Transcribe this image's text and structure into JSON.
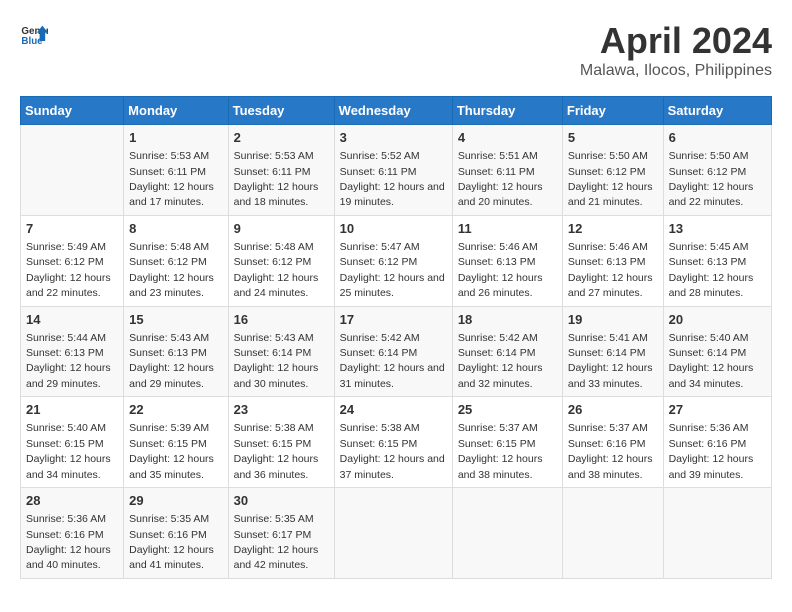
{
  "header": {
    "logo_line1": "General",
    "logo_line2": "Blue",
    "month": "April 2024",
    "location": "Malawa, Ilocos, Philippines"
  },
  "weekdays": [
    "Sunday",
    "Monday",
    "Tuesday",
    "Wednesday",
    "Thursday",
    "Friday",
    "Saturday"
  ],
  "weeks": [
    [
      {
        "day": "",
        "sunrise": "",
        "sunset": "",
        "daylight": ""
      },
      {
        "day": "1",
        "sunrise": "5:53 AM",
        "sunset": "6:11 PM",
        "daylight": "12 hours and 17 minutes."
      },
      {
        "day": "2",
        "sunrise": "5:53 AM",
        "sunset": "6:11 PM",
        "daylight": "12 hours and 18 minutes."
      },
      {
        "day": "3",
        "sunrise": "5:52 AM",
        "sunset": "6:11 PM",
        "daylight": "12 hours and 19 minutes."
      },
      {
        "day": "4",
        "sunrise": "5:51 AM",
        "sunset": "6:11 PM",
        "daylight": "12 hours and 20 minutes."
      },
      {
        "day": "5",
        "sunrise": "5:50 AM",
        "sunset": "6:12 PM",
        "daylight": "12 hours and 21 minutes."
      },
      {
        "day": "6",
        "sunrise": "5:50 AM",
        "sunset": "6:12 PM",
        "daylight": "12 hours and 22 minutes."
      }
    ],
    [
      {
        "day": "7",
        "sunrise": "5:49 AM",
        "sunset": "6:12 PM",
        "daylight": "12 hours and 22 minutes."
      },
      {
        "day": "8",
        "sunrise": "5:48 AM",
        "sunset": "6:12 PM",
        "daylight": "12 hours and 23 minutes."
      },
      {
        "day": "9",
        "sunrise": "5:48 AM",
        "sunset": "6:12 PM",
        "daylight": "12 hours and 24 minutes."
      },
      {
        "day": "10",
        "sunrise": "5:47 AM",
        "sunset": "6:12 PM",
        "daylight": "12 hours and 25 minutes."
      },
      {
        "day": "11",
        "sunrise": "5:46 AM",
        "sunset": "6:13 PM",
        "daylight": "12 hours and 26 minutes."
      },
      {
        "day": "12",
        "sunrise": "5:46 AM",
        "sunset": "6:13 PM",
        "daylight": "12 hours and 27 minutes."
      },
      {
        "day": "13",
        "sunrise": "5:45 AM",
        "sunset": "6:13 PM",
        "daylight": "12 hours and 28 minutes."
      }
    ],
    [
      {
        "day": "14",
        "sunrise": "5:44 AM",
        "sunset": "6:13 PM",
        "daylight": "12 hours and 29 minutes."
      },
      {
        "day": "15",
        "sunrise": "5:43 AM",
        "sunset": "6:13 PM",
        "daylight": "12 hours and 29 minutes."
      },
      {
        "day": "16",
        "sunrise": "5:43 AM",
        "sunset": "6:14 PM",
        "daylight": "12 hours and 30 minutes."
      },
      {
        "day": "17",
        "sunrise": "5:42 AM",
        "sunset": "6:14 PM",
        "daylight": "12 hours and 31 minutes."
      },
      {
        "day": "18",
        "sunrise": "5:42 AM",
        "sunset": "6:14 PM",
        "daylight": "12 hours and 32 minutes."
      },
      {
        "day": "19",
        "sunrise": "5:41 AM",
        "sunset": "6:14 PM",
        "daylight": "12 hours and 33 minutes."
      },
      {
        "day": "20",
        "sunrise": "5:40 AM",
        "sunset": "6:14 PM",
        "daylight": "12 hours and 34 minutes."
      }
    ],
    [
      {
        "day": "21",
        "sunrise": "5:40 AM",
        "sunset": "6:15 PM",
        "daylight": "12 hours and 34 minutes."
      },
      {
        "day": "22",
        "sunrise": "5:39 AM",
        "sunset": "6:15 PM",
        "daylight": "12 hours and 35 minutes."
      },
      {
        "day": "23",
        "sunrise": "5:38 AM",
        "sunset": "6:15 PM",
        "daylight": "12 hours and 36 minutes."
      },
      {
        "day": "24",
        "sunrise": "5:38 AM",
        "sunset": "6:15 PM",
        "daylight": "12 hours and 37 minutes."
      },
      {
        "day": "25",
        "sunrise": "5:37 AM",
        "sunset": "6:15 PM",
        "daylight": "12 hours and 38 minutes."
      },
      {
        "day": "26",
        "sunrise": "5:37 AM",
        "sunset": "6:16 PM",
        "daylight": "12 hours and 38 minutes."
      },
      {
        "day": "27",
        "sunrise": "5:36 AM",
        "sunset": "6:16 PM",
        "daylight": "12 hours and 39 minutes."
      }
    ],
    [
      {
        "day": "28",
        "sunrise": "5:36 AM",
        "sunset": "6:16 PM",
        "daylight": "12 hours and 40 minutes."
      },
      {
        "day": "29",
        "sunrise": "5:35 AM",
        "sunset": "6:16 PM",
        "daylight": "12 hours and 41 minutes."
      },
      {
        "day": "30",
        "sunrise": "5:35 AM",
        "sunset": "6:17 PM",
        "daylight": "12 hours and 42 minutes."
      },
      {
        "day": "",
        "sunrise": "",
        "sunset": "",
        "daylight": ""
      },
      {
        "day": "",
        "sunrise": "",
        "sunset": "",
        "daylight": ""
      },
      {
        "day": "",
        "sunrise": "",
        "sunset": "",
        "daylight": ""
      },
      {
        "day": "",
        "sunrise": "",
        "sunset": "",
        "daylight": ""
      }
    ]
  ],
  "labels": {
    "sunrise_prefix": "Sunrise: ",
    "sunset_prefix": "Sunset: ",
    "daylight_prefix": "Daylight: "
  }
}
